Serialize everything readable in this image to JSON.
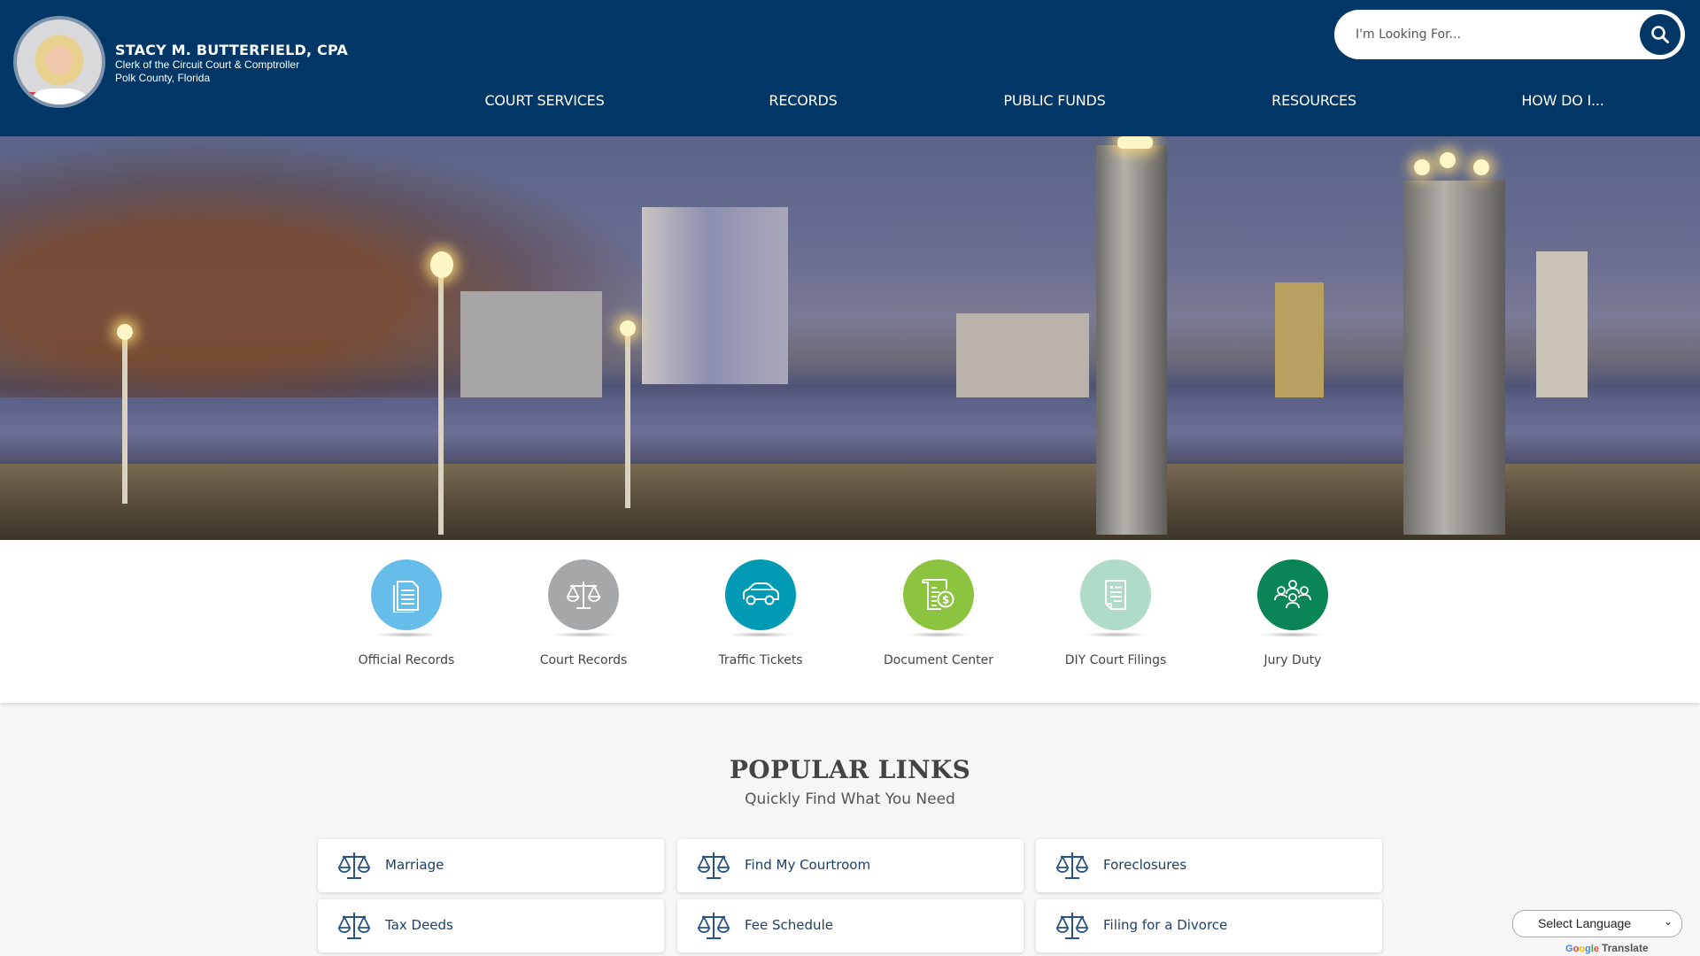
{
  "header": {
    "name": "STACY M. BUTTERFIELD, CPA",
    "title": "Clerk of the Circuit Court & Comptroller",
    "location": "Polk County, Florida",
    "portrait_alt": "Portrait of Stacy M. Butterfield",
    "bg_color": "#003766"
  },
  "search": {
    "placeholder": "I'm Looking For...",
    "value": "",
    "button_icon": "search-icon"
  },
  "nav": {
    "items": [
      {
        "label": "COURT SERVICES"
      },
      {
        "label": "RECORDS"
      },
      {
        "label": "PUBLIC FUNDS"
      },
      {
        "label": "RESOURCES"
      },
      {
        "label": "HOW DO I..."
      }
    ]
  },
  "hero": {
    "alt": "Lakeside downtown skyline at dusk with lit lamp posts and stone pillars"
  },
  "quick_links": [
    {
      "label": "Official Records",
      "icon": "document-icon",
      "color": "#67bdea"
    },
    {
      "label": "Court Records",
      "icon": "scales-icon",
      "color": "#a6a7a9"
    },
    {
      "label": "Traffic Tickets",
      "icon": "car-icon",
      "color": "#009ab5"
    },
    {
      "label": "Document Center",
      "icon": "receipt-dollar-icon",
      "color": "#8cc43f"
    },
    {
      "label": "DIY Court Filings",
      "icon": "form-icon",
      "color": "#b0dcc7"
    },
    {
      "label": "Jury Duty",
      "icon": "people-group-icon",
      "color": "#098556"
    }
  ],
  "popular": {
    "title": "POPULAR LINKS",
    "subtitle": "Quickly Find What You Need",
    "links": [
      {
        "label": "Marriage",
        "icon": "scales-icon"
      },
      {
        "label": "Find My Courtroom",
        "icon": "scales-icon"
      },
      {
        "label": "Foreclosures",
        "icon": "scales-icon"
      },
      {
        "label": "Tax Deeds",
        "icon": "scales-icon"
      },
      {
        "label": "Fee Schedule",
        "icon": "scales-icon"
      },
      {
        "label": "Filing for a Divorce",
        "icon": "scales-icon"
      }
    ]
  },
  "translate": {
    "select_label": "Select Language",
    "powered_by": "Google",
    "product": "Translate"
  }
}
